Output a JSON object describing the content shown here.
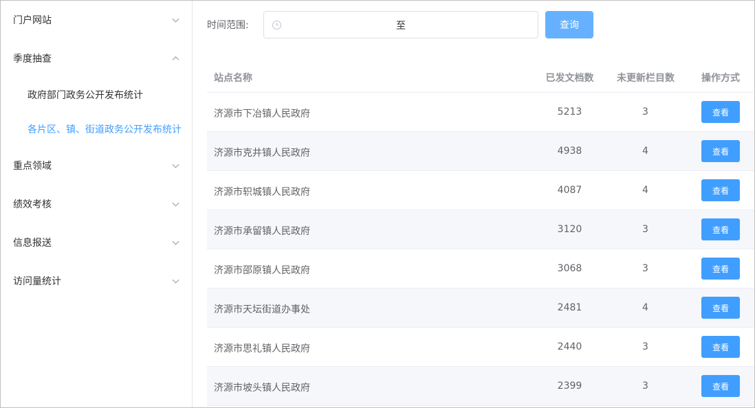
{
  "sidebar": {
    "menus": [
      {
        "label": "门户网站",
        "expanded": false
      },
      {
        "label": "季度抽查",
        "expanded": true,
        "children": [
          {
            "label": "政府部门政务公开发布统计",
            "active": false
          },
          {
            "label": "各片区、镇、街道政务公开发布统计",
            "active": true
          }
        ]
      },
      {
        "label": "重点领域",
        "expanded": false
      },
      {
        "label": "绩效考核",
        "expanded": false
      },
      {
        "label": "信息报送",
        "expanded": false
      },
      {
        "label": "访问量统计",
        "expanded": false
      }
    ]
  },
  "filter": {
    "label": "时间范围:",
    "range_separator": "至",
    "start_placeholder": "",
    "end_placeholder": "",
    "query_label": "查询"
  },
  "table": {
    "headers": {
      "name": "站点名称",
      "docs": "已发文档数",
      "stale": "未更新栏目数",
      "action": "操作方式"
    },
    "view_label": "查看",
    "rows": [
      {
        "name": "济源市下冶镇人民政府",
        "docs": "5213",
        "stale": "3"
      },
      {
        "name": "济源市克井镇人民政府",
        "docs": "4938",
        "stale": "4"
      },
      {
        "name": "济源市轵城镇人民政府",
        "docs": "4087",
        "stale": "4"
      },
      {
        "name": "济源市承留镇人民政府",
        "docs": "3120",
        "stale": "3"
      },
      {
        "name": "济源市邵原镇人民政府",
        "docs": "3068",
        "stale": "3"
      },
      {
        "name": "济源市天坛街道办事处",
        "docs": "2481",
        "stale": "4"
      },
      {
        "name": "济源市思礼镇人民政府",
        "docs": "2440",
        "stale": "3"
      },
      {
        "name": "济源市坡头镇人民政府",
        "docs": "2399",
        "stale": "3"
      }
    ]
  },
  "colors": {
    "accent": "#409eff",
    "query_button": "#66b1ff",
    "stripe": "#f5f7fa"
  }
}
